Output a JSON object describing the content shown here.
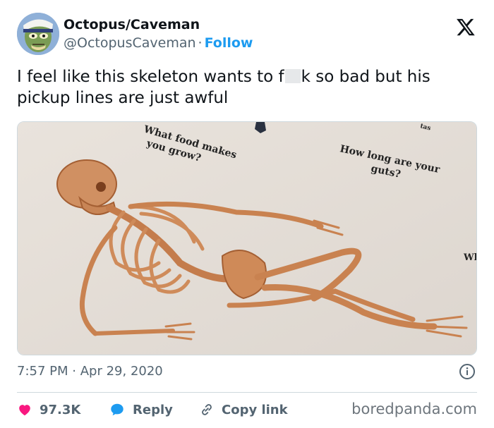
{
  "user": {
    "name": "Octopus/Caveman",
    "handle": "@OctopusCaveman",
    "separator": "·",
    "follow_label": "Follow"
  },
  "tweet": {
    "text_before": "I feel like this skeleton wants to f",
    "text_after": "k so bad but his pickup lines are just awful"
  },
  "image": {
    "caption_left": [
      "What food makes",
      "you grow?"
    ],
    "caption_right": [
      "How long are your",
      "guts?"
    ],
    "caption_edge": "Wh",
    "caption_top": "tas"
  },
  "timestamp": {
    "time": "7:57 PM",
    "separator": "·",
    "date": "Apr 29, 2020"
  },
  "actions": {
    "likes": "97.3K",
    "reply": "Reply",
    "copy_link": "Copy link"
  },
  "watermark": "boredpanda.com",
  "colors": {
    "accent": "#1d9bf0",
    "like": "#f91880",
    "text": "#0f1419",
    "muted": "#536471"
  },
  "icons": [
    "x-logo-icon",
    "info-icon",
    "heart-icon",
    "reply-bubble-icon",
    "link-icon"
  ]
}
